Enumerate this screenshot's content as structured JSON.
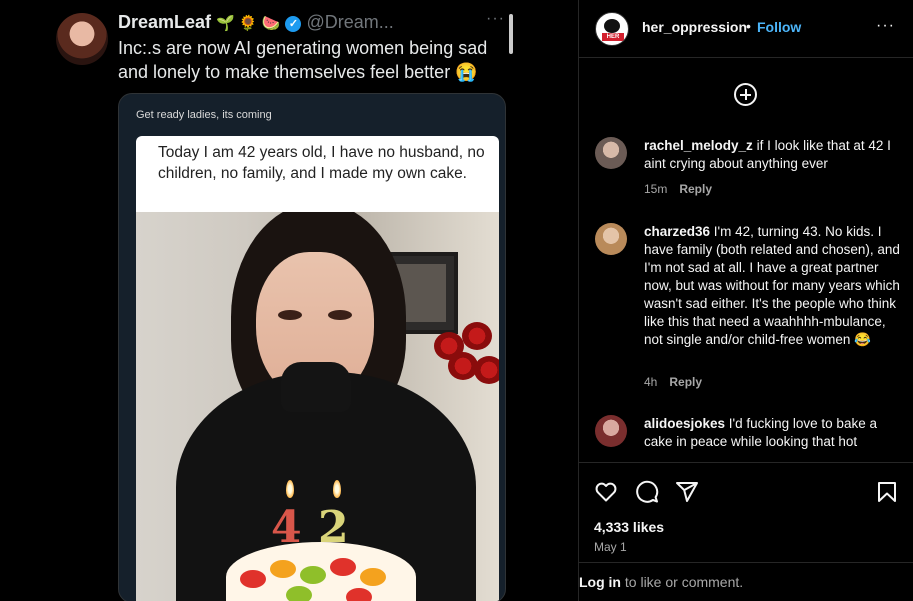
{
  "tweet": {
    "display_name": "DreamLeaf",
    "emojis": "🌱 🌻 🍉",
    "handle": "@Dream...",
    "more": "···",
    "text": "Inc:.s are now AI generating women being sad and lonely to make themselves feel better 😭",
    "quote_caption": "Get ready ladies, its coming",
    "meme_text": "Today I am 42 years old, I have no husband, no children, no family, and I made my own cake.",
    "candle_digits": [
      "4",
      "2"
    ]
  },
  "post": {
    "username": "her_oppression",
    "separator": "•",
    "follow_label": "Follow",
    "more": "···",
    "avatar_badge": "HER",
    "likes": "4,333 likes",
    "date": "May 1",
    "login_link": "Log in",
    "login_rest": " to like or comment."
  },
  "comments": [
    {
      "user": "rachel_melody_z",
      "text": " if I look like that at 42 I aint crying about anything ever",
      "time": "15m",
      "reply": "Reply",
      "avatar_color": "#6b5b55"
    },
    {
      "user": "charzed36",
      "text": " I'm 42, turning 43. No kids. I have family (both related and chosen), and I'm not sad at all. I have a great partner now, but was without for many years which wasn't sad either. It's the people who think like this that need a waahhhh-mbulance, not single and/or child-free women 😂",
      "time": "4h",
      "reply": "Reply",
      "avatar_color": "#b98a5a"
    },
    {
      "user": "alidoesjokes",
      "text": " I'd fucking love to bake a cake in peace while looking that hot",
      "time": "",
      "reply": "",
      "avatar_color": "#7a2e2e"
    }
  ],
  "icons": {
    "like": "heart-icon",
    "comment": "comment-icon",
    "share": "share-icon",
    "save": "bookmark-icon",
    "add": "add-circle-icon"
  },
  "colors": {
    "follow": "#4cb5f9",
    "verified": "#1d9bf0",
    "background": "#000000"
  }
}
